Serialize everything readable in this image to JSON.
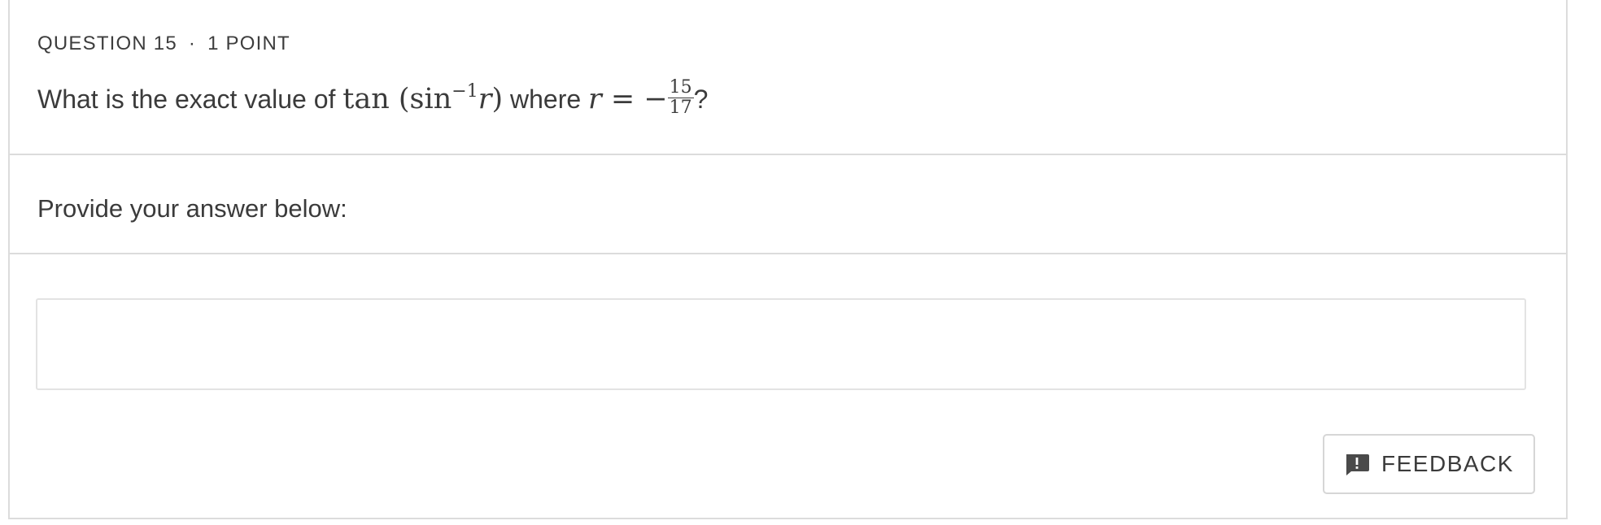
{
  "question": {
    "label": "QUESTION 15",
    "separator": "·",
    "points": "1 POINT",
    "text_before": "What is the exact value of ",
    "math_expr": {
      "func": "tan",
      "open": " (sin",
      "exponent": "−1",
      "var": "r",
      "close": ")"
    },
    "text_middle": " where ",
    "math_eq": {
      "var": "r",
      "equals": " = −",
      "numerator": "15",
      "denominator": "17"
    },
    "text_after": "?"
  },
  "answer": {
    "prompt": "Provide your answer below:",
    "value": "",
    "placeholder": ""
  },
  "feedback": {
    "label": "FEEDBACK",
    "icon": "feedback-icon"
  },
  "colors": {
    "border": "#dcdcdc",
    "text": "#3b3b3b",
    "background": "#ffffff"
  }
}
